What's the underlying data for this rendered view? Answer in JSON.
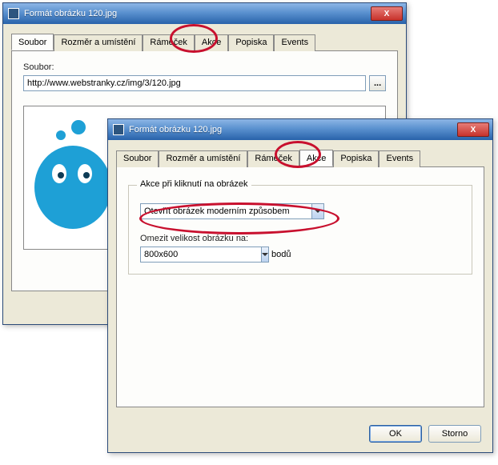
{
  "window1": {
    "title": "Formát obrázku 120.jpg",
    "close": "X",
    "tabs": [
      "Soubor",
      "Rozměr a umístění",
      "Rámeček",
      "Akce",
      "Popiska",
      "Events"
    ],
    "active_tab": 0,
    "soubor_label": "Soubor:",
    "soubor_value": "http://www.webstranky.cz/img/3/120.jpg",
    "browse": "..."
  },
  "window2": {
    "title": "Formát obrázku 120.jpg",
    "close": "X",
    "tabs": [
      "Soubor",
      "Rozměr a umístění",
      "Rámeček",
      "Akce",
      "Popiska",
      "Events"
    ],
    "active_tab": 3,
    "group_title": "Akce při kliknutí na obrázek",
    "action_value": "Otevřít obrázek moderním způsobem",
    "limit_label": "Omezit velikost obrázku na:",
    "limit_value": "800x600",
    "limit_unit": "bodů",
    "ok": "OK",
    "cancel": "Storno"
  }
}
